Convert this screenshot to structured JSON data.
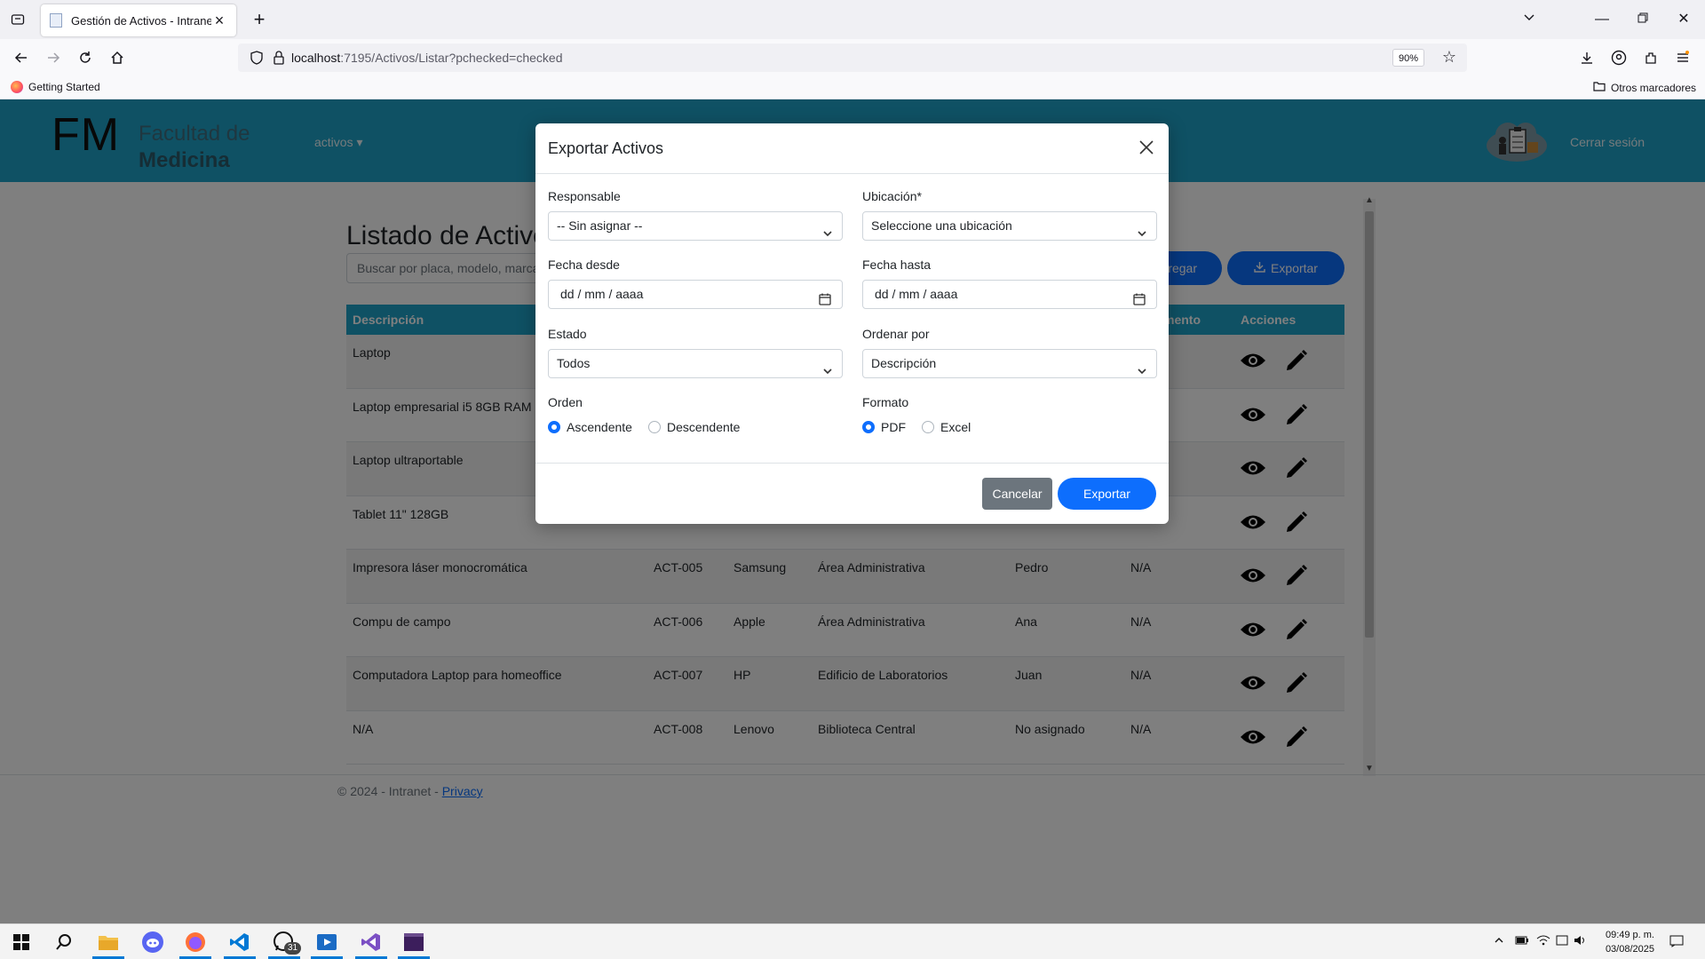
{
  "browser": {
    "tab_title": "Gestión de Activos - Intranet",
    "url_host": "localhost",
    "url_path": ":7195/Activos/Listar?pchecked=checked",
    "zoom": "90%",
    "bookmark_getting_started": "Getting Started",
    "bookmark_other": "Otros marcadores"
  },
  "header": {
    "logo_short": "FM",
    "logo_line1": "Facultad de",
    "logo_line2": "Medicina",
    "menu_activos": "activos ▾",
    "logout": "Cerrar sesión",
    "brand_color": "#1fa3c9"
  },
  "page": {
    "title": "Listado de Activos",
    "search_placeholder": "Buscar por placa, modelo, marca",
    "add_label": "Agregar",
    "export_label": "Exportar"
  },
  "table": {
    "headers": {
      "descripcion": "Descripción",
      "departamento": "Departamento",
      "acciones": "Acciones"
    },
    "rows": [
      {
        "descripcion": "Laptop",
        "placa": "",
        "marca": "",
        "ubicacion": "",
        "responsable": "",
        "depto": ""
      },
      {
        "descripcion": "Laptop empresarial i5 8GB RAM",
        "placa": "",
        "marca": "",
        "ubicacion": "",
        "responsable": "",
        "depto": ""
      },
      {
        "descripcion": "Laptop ultraportable",
        "placa": "",
        "marca": "",
        "ubicacion": "",
        "responsable": "",
        "depto": ""
      },
      {
        "descripcion": "Tablet 11\" 128GB",
        "placa": "",
        "marca": "",
        "ubicacion": "",
        "responsable": "",
        "depto": ""
      },
      {
        "descripcion": "Impresora láser monocromática",
        "placa": "ACT-005",
        "marca": "Samsung",
        "ubicacion": "Área Administrativa",
        "responsable": "Pedro",
        "depto": "N/A"
      },
      {
        "descripcion": "Compu de campo",
        "placa": "ACT-006",
        "marca": "Apple",
        "ubicacion": "Área Administrativa",
        "responsable": "Ana",
        "depto": "N/A"
      },
      {
        "descripcion": "Computadora Laptop para homeoffice",
        "placa": "ACT-007",
        "marca": "HP",
        "ubicacion": "Edificio de Laboratorios",
        "responsable": "Juan",
        "depto": "N/A"
      },
      {
        "descripcion": "N/A",
        "placa": "ACT-008",
        "marca": "Lenovo",
        "ubicacion": "Biblioteca Central",
        "responsable": "No asignado",
        "depto": "N/A"
      }
    ]
  },
  "footer": {
    "text": "© 2024 - Intranet -",
    "privacy": "Privacy"
  },
  "modal": {
    "title": "Exportar Activos",
    "responsable_label": "Responsable",
    "responsable_value": "-- Sin asignar --",
    "ubicacion_label": "Ubicación*",
    "ubicacion_value": "Seleccione una ubicación",
    "fecha_desde_label": "Fecha desde",
    "fecha_desde_value": "dd / mm / aaaa",
    "fecha_hasta_label": "Fecha hasta",
    "fecha_hasta_value": "dd / mm / aaaa",
    "estado_label": "Estado",
    "estado_value": "Todos",
    "ordenar_label": "Ordenar por",
    "ordenar_value": "Descripción",
    "orden_label": "Orden",
    "orden_asc": "Ascendente",
    "orden_desc": "Descendente",
    "formato_label": "Formato",
    "formato_pdf": "PDF",
    "formato_excel": "Excel",
    "cancel": "Cancelar",
    "export": "Exportar"
  },
  "taskbar": {
    "time": "09:49 p. m.",
    "date": "03/08/2025",
    "whatsapp_badge": "31"
  }
}
